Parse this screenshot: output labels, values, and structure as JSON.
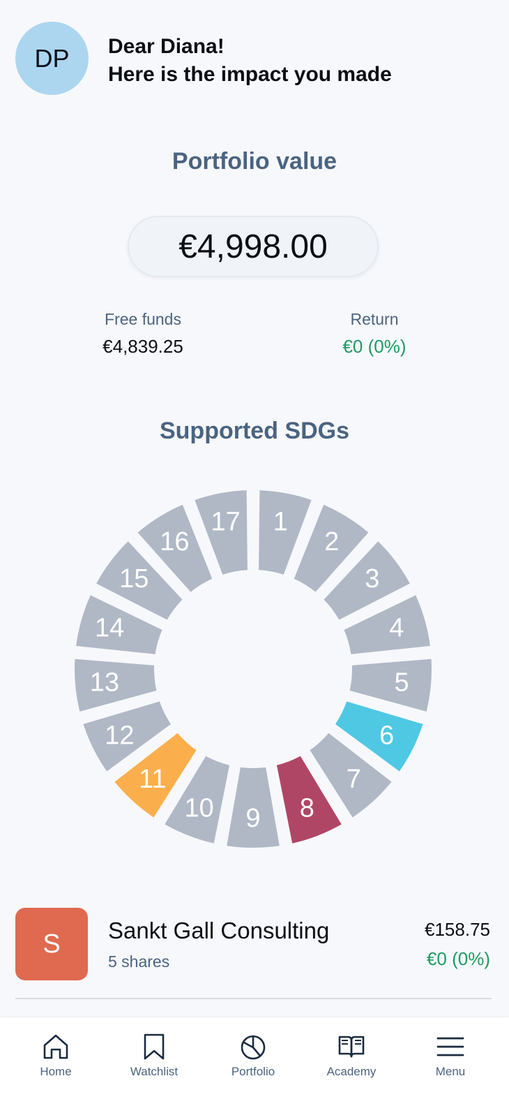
{
  "header": {
    "avatar_initials": "DP",
    "greeting_line1": "Dear Diana!",
    "greeting_line2": "Here is the impact you made"
  },
  "portfolio": {
    "title": "Portfolio value",
    "value": "€4,998.00",
    "free_funds_label": "Free funds",
    "free_funds_value": "€4,839.25",
    "return_label": "Return",
    "return_value": "€0 (0%)"
  },
  "sdgs": {
    "title": "Supported SDGs",
    "default_color": "#b0b8c6",
    "goals": [
      {
        "number": "1",
        "active": false
      },
      {
        "number": "2",
        "active": false
      },
      {
        "number": "3",
        "active": false
      },
      {
        "number": "4",
        "active": false
      },
      {
        "number": "5",
        "active": false
      },
      {
        "number": "6",
        "active": true,
        "color": "#4fc8e4"
      },
      {
        "number": "7",
        "active": false
      },
      {
        "number": "8",
        "active": true,
        "color": "#b04665"
      },
      {
        "number": "9",
        "active": false
      },
      {
        "number": "10",
        "active": false
      },
      {
        "number": "11",
        "active": true,
        "color": "#fbaf4c"
      },
      {
        "number": "12",
        "active": false
      },
      {
        "number": "13",
        "active": false
      },
      {
        "number": "14",
        "active": false
      },
      {
        "number": "15",
        "active": false
      },
      {
        "number": "16",
        "active": false
      },
      {
        "number": "17",
        "active": false
      }
    ]
  },
  "holdings": [
    {
      "logo_letter": "S",
      "logo_color": "#e06a50",
      "name": "Sankt Gall Consulting",
      "shares": "5 shares",
      "value": "€158.75",
      "return": "€0 (0%)"
    }
  ],
  "nav": {
    "items": [
      {
        "label": "Home",
        "icon": "home-icon"
      },
      {
        "label": "Watchlist",
        "icon": "bookmark-icon"
      },
      {
        "label": "Portfolio",
        "icon": "pie-chart-icon"
      },
      {
        "label": "Academy",
        "icon": "book-icon"
      },
      {
        "label": "Menu",
        "icon": "hamburger-icon"
      }
    ]
  }
}
